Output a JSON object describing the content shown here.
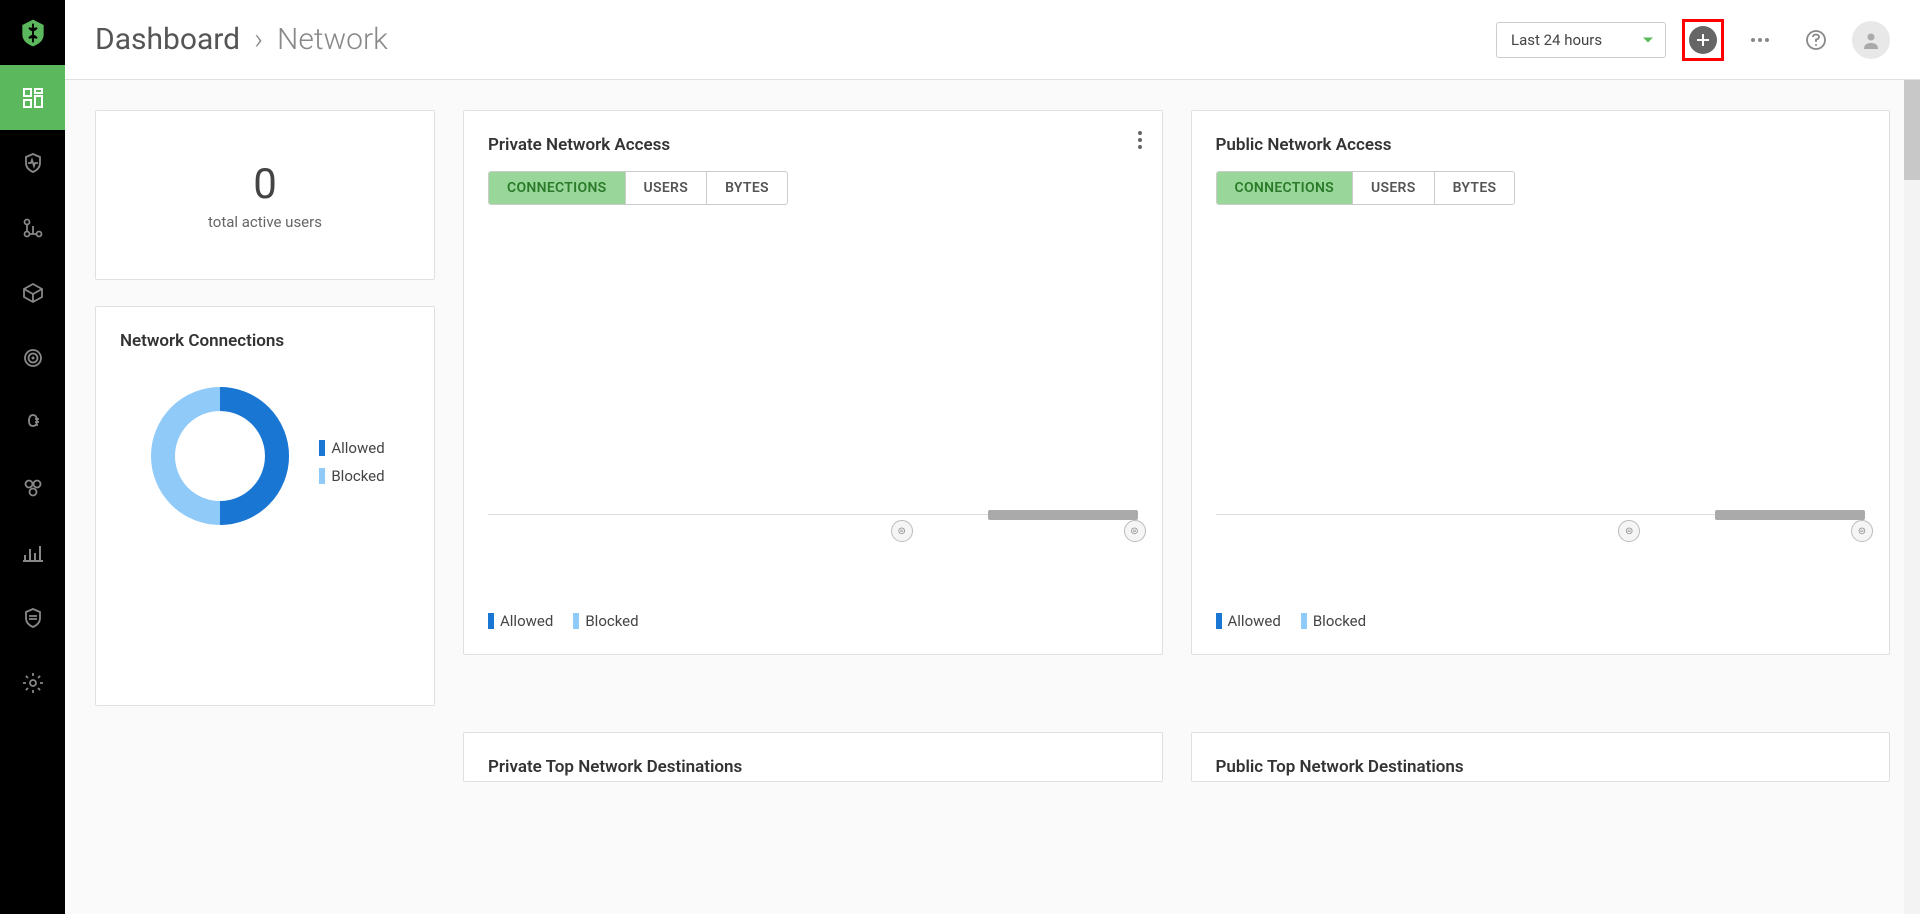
{
  "breadcrumb": {
    "root": "Dashboard",
    "current": "Network"
  },
  "header": {
    "time_range": "Last 24 hours"
  },
  "stats": {
    "active_users_value": "0",
    "active_users_label": "total active users"
  },
  "cards": {
    "connections_title": "Network Connections",
    "private_title": "Private Network Access",
    "public_title": "Public Network Access",
    "private_dest_title": "Private Top Network Destinations",
    "public_dest_title": "Public Top Network Destinations"
  },
  "tabs": {
    "connections": "CONNECTIONS",
    "users": "USERS",
    "bytes": "BYTES"
  },
  "legend": {
    "allowed": "Allowed",
    "blocked": "Blocked"
  },
  "colors": {
    "accent": "#5cb85c",
    "allowed": "#1976d2",
    "blocked": "#90caf9",
    "highlight": "#ff0000"
  },
  "chart_data": [
    {
      "type": "pie",
      "title": "Network Connections",
      "series": [
        {
          "name": "Allowed",
          "value": 50,
          "color": "#1976d2"
        },
        {
          "name": "Blocked",
          "value": 50,
          "color": "#90caf9"
        }
      ]
    },
    {
      "type": "bar",
      "title": "Private Network Access",
      "categories": [],
      "series": [
        {
          "name": "Allowed",
          "values": []
        },
        {
          "name": "Blocked",
          "values": []
        }
      ],
      "xlabel": "",
      "ylabel": ""
    },
    {
      "type": "bar",
      "title": "Public Network Access",
      "categories": [],
      "series": [
        {
          "name": "Allowed",
          "values": []
        },
        {
          "name": "Blocked",
          "values": []
        }
      ],
      "xlabel": "",
      "ylabel": ""
    }
  ]
}
